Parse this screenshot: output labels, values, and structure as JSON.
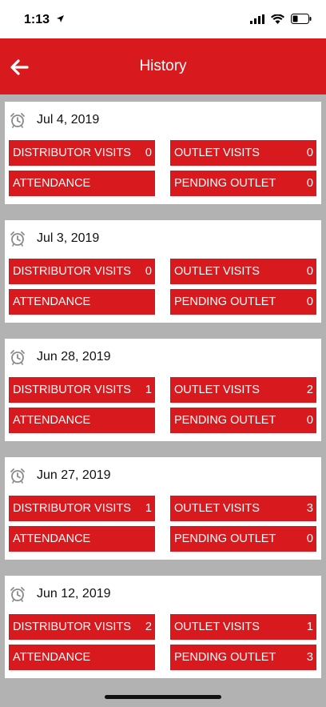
{
  "status_bar": {
    "time": "1:13"
  },
  "header": {
    "title": "History",
    "back_icon": "arrow-left-icon"
  },
  "labels": {
    "distributor_visits": "DISTRIBUTOR VISITS",
    "outlet_visits": "OUTLET VISITS",
    "attendance": "ATTENDANCE",
    "pending_outlet": "PENDING OUTLET"
  },
  "colors": {
    "accent": "#d81a1f",
    "background": "#b2b2b2",
    "card": "#ffffff"
  },
  "history": [
    {
      "date": "Jul 4, 2019",
      "distributor_visits": "0",
      "outlet_visits": "0",
      "pending_outlet": "0"
    },
    {
      "date": "Jul 3, 2019",
      "distributor_visits": "0",
      "outlet_visits": "0",
      "pending_outlet": "0"
    },
    {
      "date": "Jun 28, 2019",
      "distributor_visits": "1",
      "outlet_visits": "2",
      "pending_outlet": "0"
    },
    {
      "date": "Jun 27, 2019",
      "distributor_visits": "1",
      "outlet_visits": "3",
      "pending_outlet": "0"
    },
    {
      "date": "Jun 12, 2019",
      "distributor_visits": "2",
      "outlet_visits": "1",
      "pending_outlet": "3"
    }
  ]
}
